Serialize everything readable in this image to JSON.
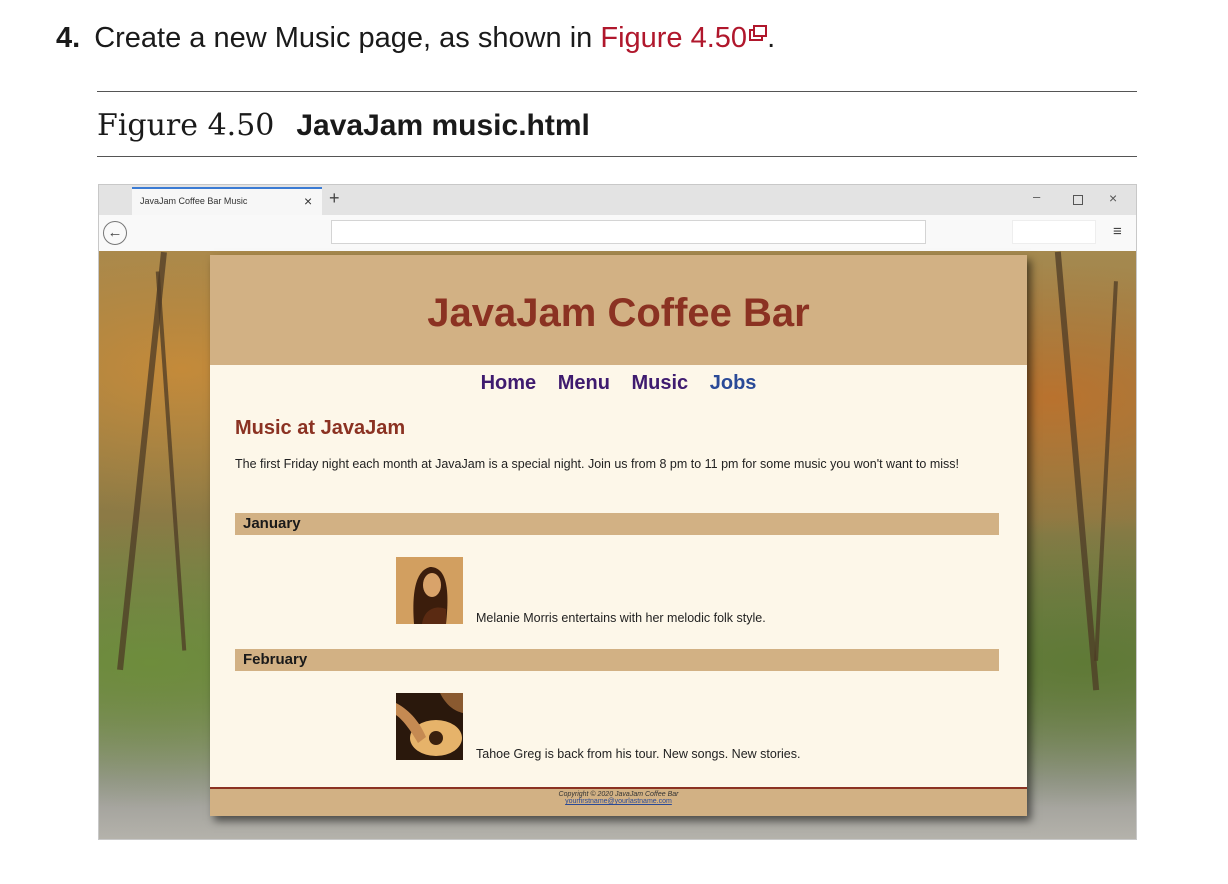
{
  "instruction": {
    "number": "4.",
    "text": "Create a new Music page, as shown in",
    "link": "Figure 4.50",
    "trailing": "."
  },
  "figure": {
    "number": "Figure 4.50",
    "title": "JavaJam music.html"
  },
  "browser": {
    "tab_title": "JavaJam Coffee Bar Music",
    "tab_close": "×",
    "new_tab": "+",
    "window_controls": {
      "minimize": "–",
      "close": "×"
    },
    "back_glyph": "←",
    "menu_glyph": "≡"
  },
  "site": {
    "title": "JavaJam Coffee Bar",
    "nav": [
      "Home",
      "Menu",
      "Music",
      "Jobs"
    ],
    "heading": "Music at JavaJam",
    "intro": "The first Friday night each month at JavaJam is a special night. Join us from 8 pm to 11 pm for some music you won't want to miss!",
    "months": [
      {
        "name": "January",
        "caption": "Melanie Morris entertains with her melodic folk style."
      },
      {
        "name": "February",
        "caption": "Tahoe Greg is back from his tour. New songs. New stories."
      }
    ],
    "footer": {
      "copyright": "Copyright © 2020 JavaJam Coffee Bar",
      "email": "yourfirstname@yourlastname.com"
    }
  },
  "colors": {
    "link_red": "#b0172c",
    "header_tan": "#d2b184",
    "title_brown": "#8b3222",
    "nav_purple": "#3f1b6f",
    "page_cream": "#fdf7e9"
  }
}
